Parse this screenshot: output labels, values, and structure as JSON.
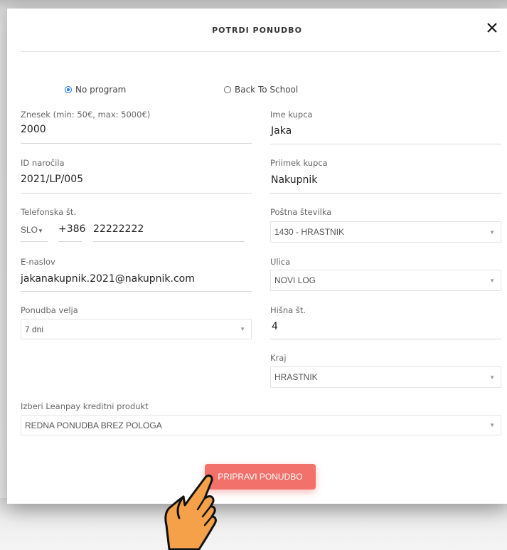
{
  "modal": {
    "title": "POTRDI PONUDBO",
    "close_icon": "close-icon"
  },
  "program_options": [
    {
      "label": "No program",
      "checked": true
    },
    {
      "label": "Back To School",
      "checked": false
    }
  ],
  "fields": {
    "amount": {
      "label": "Znesek (min: 50€, max: 5000€)",
      "value": "2000"
    },
    "first_name": {
      "label": "Ime kupca",
      "value": "Jaka"
    },
    "order_id": {
      "label": "ID naročila",
      "value": "2021/LP/005"
    },
    "last_name": {
      "label": "Priimek kupca",
      "value": "Nakupnik"
    },
    "phone": {
      "label": "Telefonska št.",
      "country": "SLO",
      "prefix": "+386",
      "number": "22222222"
    },
    "postal_code": {
      "label": "Poštna številka",
      "selected": "1430 - HRASTNIK"
    },
    "email": {
      "label": "E-naslov",
      "value": "jakanakupnik.2021@nakupnik.com"
    },
    "street": {
      "label": "Ulica",
      "selected": "NOVI LOG"
    },
    "offer_valid": {
      "label": "Ponudba velja",
      "selected": "7 dni"
    },
    "house_number": {
      "label": "Hišna št.",
      "value": "4"
    },
    "city": {
      "label": "Kraj",
      "selected": "HRASTNIK"
    },
    "credit_product": {
      "label": "Izberi Leanpay kreditni produkt",
      "selected": "REDNA PONUDBA BREZ POLOGA"
    }
  },
  "actions": {
    "submit_label": "PRIPRAVI PONUDBO"
  },
  "colors": {
    "accent_button": "#f2716b",
    "radio_checked": "#1a73e8",
    "hand_fill": "#f5a14a"
  },
  "decorations": {
    "pointer_icon": "pointing-hand-icon"
  }
}
